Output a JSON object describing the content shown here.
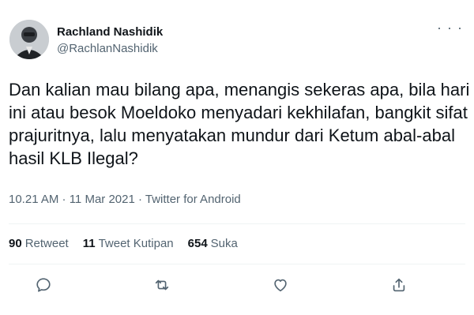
{
  "author": {
    "name": "Rachland Nashidik",
    "handle": "@RachlanNashidik",
    "avatar_icon": "avatar-photo"
  },
  "tweet": {
    "text": "Dan kalian mau bilang apa, menangis sekeras apa, bila hari ini atau besok Moeldoko menyadari kekhilafan, bangkit sifat prajuritnya, lalu menyatakan mundur dari Ketum abal-abal hasil KLB Ilegal?",
    "meta": "10.21 AM · 11 Mar 2021 · Twitter for Android"
  },
  "stats": {
    "retweets_count": "90",
    "retweets_label": "Retweet",
    "quotes_count": "11",
    "quotes_label": "Tweet Kutipan",
    "likes_count": "654",
    "likes_label": "Suka"
  },
  "actions": [
    "reply-icon",
    "retweet-icon",
    "like-icon",
    "share-icon"
  ],
  "colors": {
    "text": "#0f1419",
    "secondary": "#536471",
    "divider": "#eff3f4"
  }
}
